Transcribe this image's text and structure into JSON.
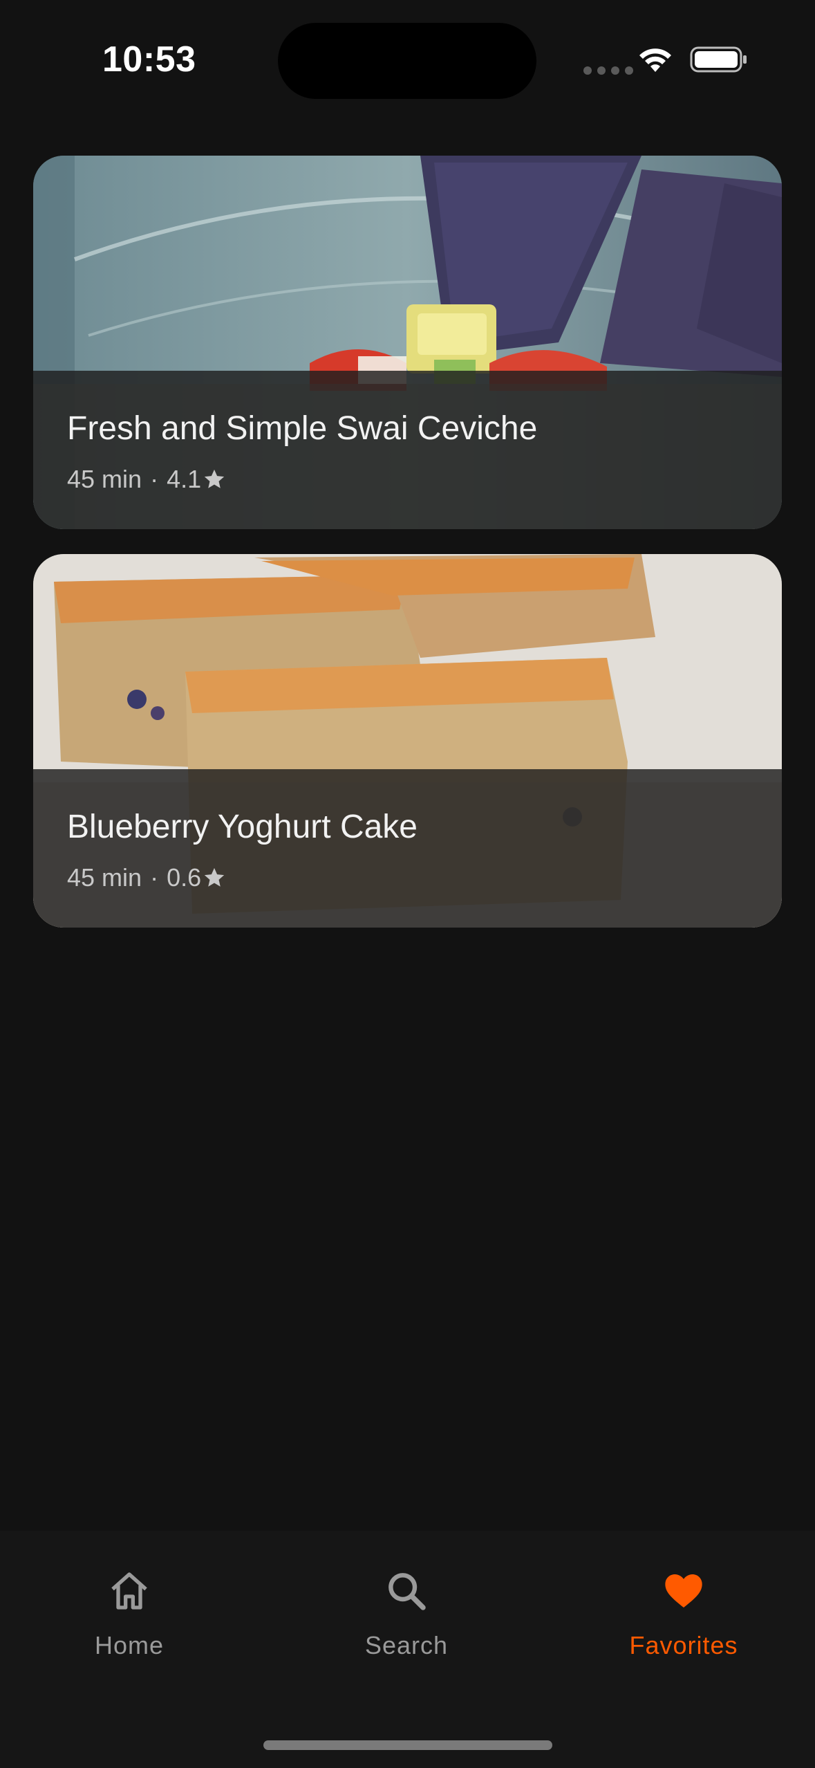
{
  "status_bar": {
    "time": "10:53"
  },
  "recipes": [
    {
      "title": "Fresh and Simple Swai Ceviche",
      "time": "45 min",
      "separator": "·",
      "rating": "4.1",
      "image_icon": "ceviche-photo"
    },
    {
      "title": "Blueberry Yoghurt Cake",
      "time": "45 min",
      "separator": "·",
      "rating": "0.6",
      "image_icon": "cake-photo"
    }
  ],
  "nav": {
    "items": [
      {
        "label": "Home",
        "icon": "home-icon",
        "active": false
      },
      {
        "label": "Search",
        "icon": "search-icon",
        "active": false
      },
      {
        "label": "Favorites",
        "icon": "heart-icon",
        "active": true
      }
    ]
  },
  "colors": {
    "background": "#121212",
    "accent": "#ff5a00",
    "inactive": "#9a9a9a"
  }
}
